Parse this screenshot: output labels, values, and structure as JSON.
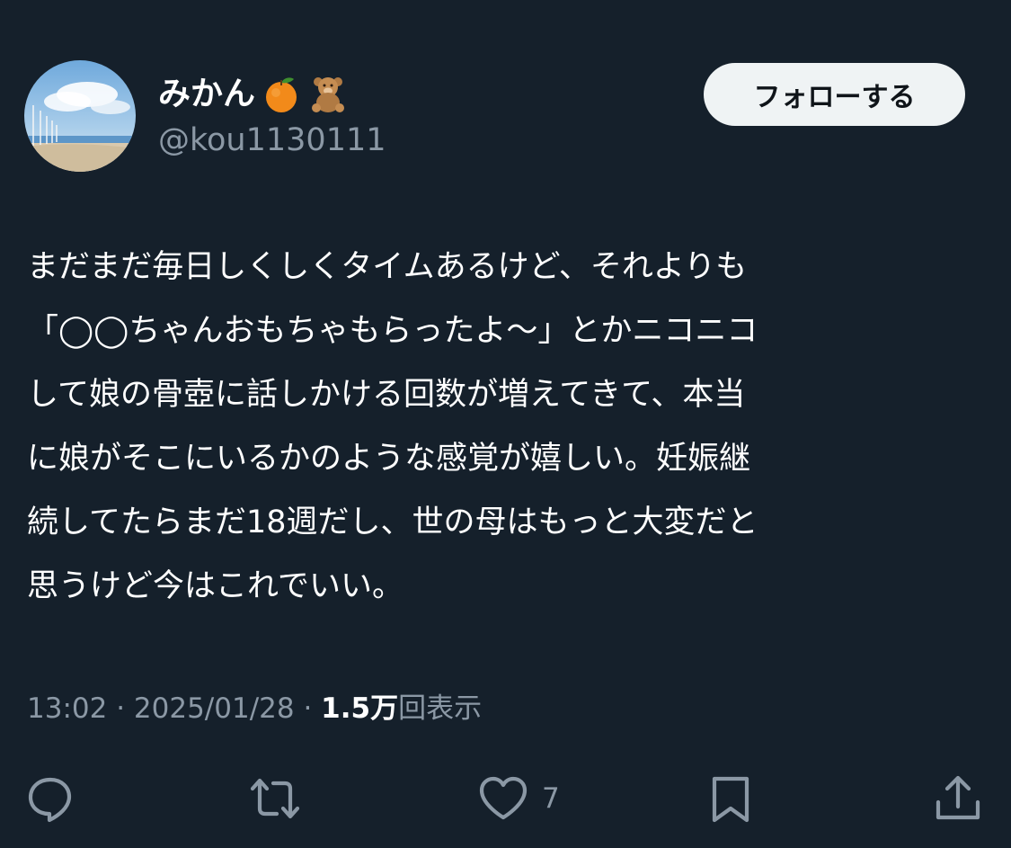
{
  "user": {
    "display_name": "みかん",
    "handle": "@kou1130111",
    "name_emojis": [
      "tangerine-icon",
      "teddy-bear-icon"
    ]
  },
  "follow_button": {
    "label": "フォローする"
  },
  "tweet": {
    "lines": [
      "まだまだ毎日しくしくタイムあるけど、それよりも",
      "「◯◯ちゃんおもちゃもらったよ〜」とかニコニコ",
      "して娘の骨壺に話しかける回数が増えてきて、本当",
      "に娘がそこにいるかのような感覚が嬉しい。妊娠継",
      "続してたらまだ18週だし、世の母はもっと大変だと",
      "思うけど今はこれでいい。"
    ]
  },
  "meta": {
    "time": "13:02",
    "separator": " · ",
    "date": "2025/01/28",
    "views_count": "1.5万",
    "views_label": "回表示"
  },
  "actions": {
    "reply_icon": "reply-icon",
    "retweet_icon": "retweet-icon",
    "like_icon": "heart-icon",
    "like_count": "7",
    "bookmark_icon": "bookmark-icon",
    "share_icon": "share-icon"
  },
  "colors": {
    "background": "#15202b",
    "text_primary": "#ffffff",
    "text_secondary": "#8b98a5",
    "follow_button_bg": "#eff3f4",
    "follow_button_text": "#0f1419"
  }
}
